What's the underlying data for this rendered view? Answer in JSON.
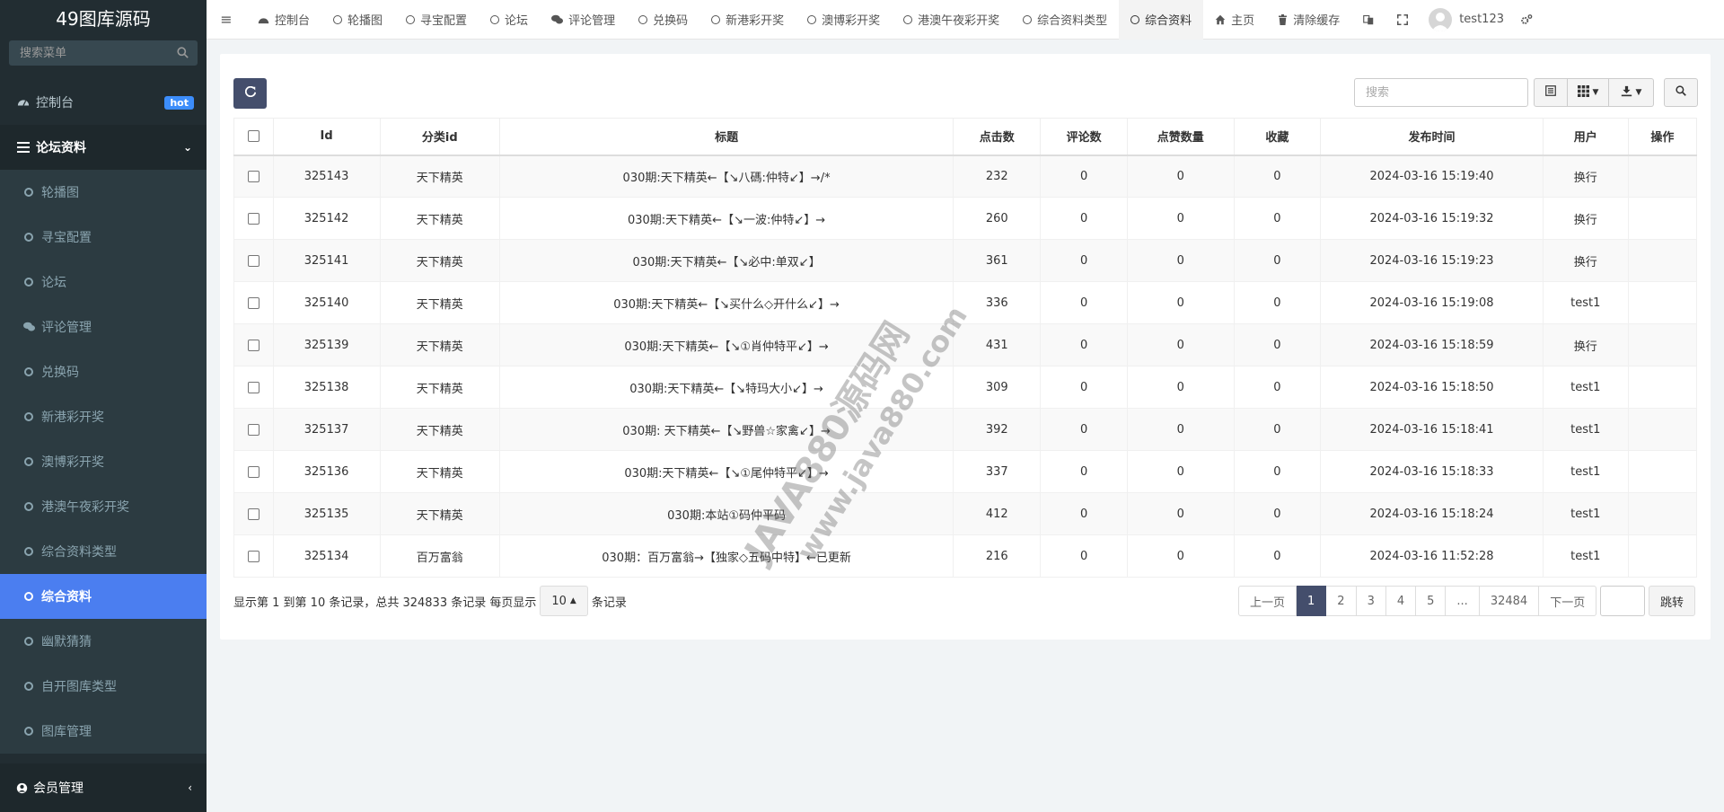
{
  "brand": "49图库源码",
  "sidebar": {
    "search_placeholder": "搜索菜单",
    "dashboard": "控制台",
    "hot_badge": "hot",
    "forum_group": "论坛资料",
    "items": [
      {
        "label": "轮播图",
        "icon": "circle-icon"
      },
      {
        "label": "寻宝配置",
        "icon": "circle-icon"
      },
      {
        "label": "论坛",
        "icon": "circle-icon"
      },
      {
        "label": "评论管理",
        "icon": "comments-icon"
      },
      {
        "label": "兑换码",
        "icon": "circle-icon"
      },
      {
        "label": "新港彩开奖",
        "icon": "circle-icon"
      },
      {
        "label": "澳博彩开奖",
        "icon": "circle-icon"
      },
      {
        "label": "港澳午夜彩开奖",
        "icon": "circle-icon"
      },
      {
        "label": "综合资料类型",
        "icon": "circle-icon"
      },
      {
        "label": "综合资料",
        "icon": "circle-icon",
        "active": true
      },
      {
        "label": "幽默猜猜",
        "icon": "circle-icon"
      },
      {
        "label": "自开图库类型",
        "icon": "circle-icon"
      },
      {
        "label": "图库管理",
        "icon": "circle-icon"
      }
    ],
    "member": "会员管理"
  },
  "topbar": {
    "tabs": [
      {
        "label": "控制台",
        "icon": "dashboard-icon"
      },
      {
        "label": "轮播图",
        "icon": "circle-icon"
      },
      {
        "label": "寻宝配置",
        "icon": "circle-icon"
      },
      {
        "label": "论坛",
        "icon": "circle-icon"
      },
      {
        "label": "评论管理",
        "icon": "comments-icon"
      },
      {
        "label": "兑换码",
        "icon": "circle-icon"
      },
      {
        "label": "新港彩开奖",
        "icon": "circle-icon"
      },
      {
        "label": "澳博彩开奖",
        "icon": "circle-icon"
      },
      {
        "label": "港澳午夜彩开奖",
        "icon": "circle-icon"
      },
      {
        "label": "综合资料类型",
        "icon": "circle-icon"
      },
      {
        "label": "综合资料",
        "icon": "circle-icon",
        "active": true
      }
    ],
    "home": "主页",
    "clear_cache": "清除缓存",
    "username": "test123"
  },
  "toolbar": {
    "search_placeholder": "搜索"
  },
  "table": {
    "headers": [
      "Id",
      "分类id",
      "标题",
      "点击数",
      "评论数",
      "点赞数量",
      "收藏",
      "发布时间",
      "用户",
      "操作"
    ],
    "rows": [
      [
        "325143",
        "天下精英",
        "030期:天下精英←【↘八碼:仲特↙】→/*",
        "232",
        "0",
        "0",
        "0",
        "2024-03-16 15:19:40",
        "换行",
        ""
      ],
      [
        "325142",
        "天下精英",
        "030期:天下精英←【↘一波:仲特↙】→",
        "260",
        "0",
        "0",
        "0",
        "2024-03-16 15:19:32",
        "换行",
        ""
      ],
      [
        "325141",
        "天下精英",
        "030期:天下精英←【↘必中:单双↙】",
        "361",
        "0",
        "0",
        "0",
        "2024-03-16 15:19:23",
        "换行",
        ""
      ],
      [
        "325140",
        "天下精英",
        "030期:天下精英←【↘买什么◇开什么↙】→",
        "336",
        "0",
        "0",
        "0",
        "2024-03-16 15:19:08",
        "test1",
        ""
      ],
      [
        "325139",
        "天下精英",
        "030期:天下精英←【↘①肖仲特平↙】→",
        "431",
        "0",
        "0",
        "0",
        "2024-03-16 15:18:59",
        "换行",
        ""
      ],
      [
        "325138",
        "天下精英",
        "030期:天下精英←【↘特玛大小↙】→",
        "309",
        "0",
        "0",
        "0",
        "2024-03-16 15:18:50",
        "test1",
        ""
      ],
      [
        "325137",
        "天下精英",
        "030期: 天下精英←【↘野兽☆家禽↙】→",
        "392",
        "0",
        "0",
        "0",
        "2024-03-16 15:18:41",
        "test1",
        ""
      ],
      [
        "325136",
        "天下精英",
        "030期:天下精英←【↘①尾仲特平↙】→",
        "337",
        "0",
        "0",
        "0",
        "2024-03-16 15:18:33",
        "test1",
        ""
      ],
      [
        "325135",
        "天下精英",
        "030期:本站①码仲平码",
        "412",
        "0",
        "0",
        "0",
        "2024-03-16 15:18:24",
        "test1",
        ""
      ],
      [
        "325134",
        "百万富翁",
        "030期：百万富翁→【独家◇五码中特】←已更新",
        "216",
        "0",
        "0",
        "0",
        "2024-03-16 11:52:28",
        "test1",
        ""
      ]
    ]
  },
  "footer": {
    "info_prefix": "显示第 1 到第 10 条记录，总共 324833 条记录 每页显示",
    "page_size": "10",
    "info_suffix": "条记录",
    "pages": [
      "上一页",
      "1",
      "2",
      "3",
      "4",
      "5",
      "...",
      "32484",
      "下一页"
    ],
    "active_page": "1",
    "jump": "跳转"
  },
  "watermark": {
    "line1": "JAVA880源码网",
    "line2": "www.java880.com"
  },
  "colors": {
    "sidebar_bg": "#222d32",
    "active_menu": "#4b7ef0",
    "primary_btn": "#444e6c"
  }
}
